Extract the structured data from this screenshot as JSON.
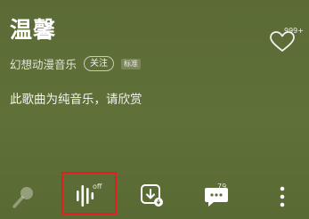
{
  "song": {
    "title": "温馨",
    "artist": "幻想动漫音乐",
    "follow_label": "关注",
    "quality_badge": "标准",
    "like_count": "999+",
    "notice": "此歌曲为纯音乐，请欣赏"
  },
  "bottom_bar": {
    "sound_effect_status": "off",
    "comment_count": "79"
  },
  "colors": {
    "background": "#5d6e38",
    "highlight_box": "#e02020"
  }
}
